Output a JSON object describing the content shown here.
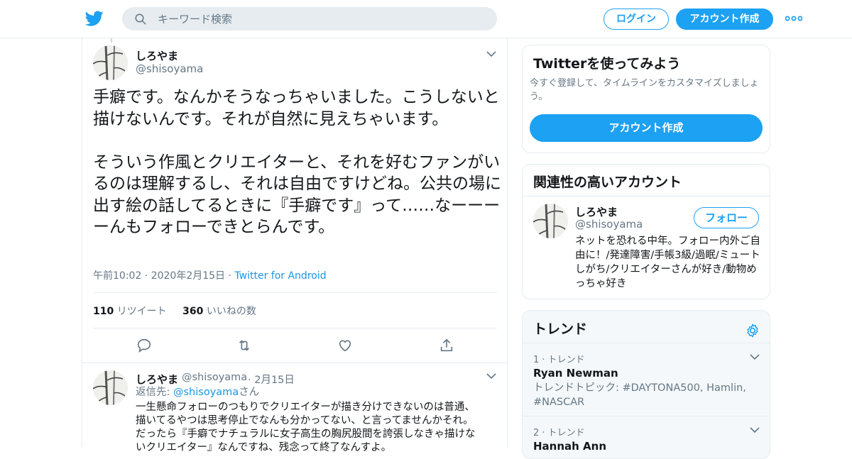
{
  "colors": {
    "accent": "#1da1f2",
    "link": "#1b95e0",
    "muted": "#657786",
    "border": "#e6ecf0"
  },
  "header": {
    "logo_icon": "twitter-bird-icon",
    "search_placeholder": "キーワード検索",
    "login_label": "ログイン",
    "signup_label": "アカウント作成",
    "more_icon": "more-dots-icon"
  },
  "tweet": {
    "name": "しろやま",
    "handle": "@shisoyama",
    "text": "手癖です。なんかそうなっちゃいました。こうしないと描けないんです。それが自然に見えちゃいます。\n\nそういう作風とクリエイターと、それを好むファンがいるのは理解するし、それは自由ですけどね。公共の場に出す絵の話してるときに『手癖です』って……なーーーーんもフォローできとらんです。",
    "time": "午前10:02 · 2020年2月15日",
    "dot": " · ",
    "source": "Twitter for Android",
    "retweets_count": "110",
    "retweets_label": "リツイート",
    "likes_count": "360",
    "likes_label": "いいねの数"
  },
  "reply": {
    "name": "しろやま",
    "handle": "@shisoyama",
    "date": "· 2月15日",
    "replying_to_prefix": "返信先: ",
    "replying_to_handle": "@shisoyama",
    "replying_to_suffix": "さん",
    "lines": [
      "一生懸命フォローのつもりでクリエイターが描き分けできないのは普通、",
      "描いてるやつは思考停止でなんも分かってない、と言ってませんかそれ。",
      "だったら『手癖でナチュラルに女子高生の胸尻股間を誇張しなきゃ描けな",
      "いクリエイター』なんですね、残念って終了なんすよ。"
    ]
  },
  "signup_card": {
    "title": "Twitterを使ってみよう",
    "subtitle": "今すぐ登録して、タイムラインをカスタマイズしましょう。",
    "button": "アカウント作成"
  },
  "related_card": {
    "title": "関連性の高いアカウント",
    "name": "しろやま",
    "handle": "@shisoyama",
    "follow": "フォロー",
    "bio": "ネットを恐れる中年。フォロー内外ご自由に！/発達障害/手帳3級/過眠/ミュートしがち/クリエイターさんが好き/動物めっちゃ好き"
  },
  "trends": {
    "title": "トレンド",
    "items": [
      {
        "rank": "1 · トレンド",
        "name": "Ryan Newman",
        "desc": "トレンドトピック: #DAYTONA500, Hamlin, #NASCAR"
      },
      {
        "rank": "2 · トレンド",
        "name": "Hannah Ann",
        "desc": ""
      }
    ]
  }
}
